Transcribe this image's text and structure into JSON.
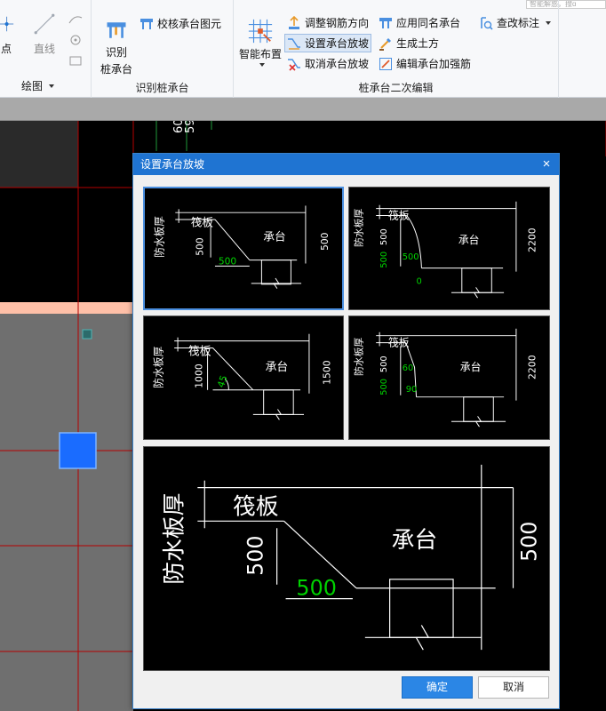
{
  "ribbon": {
    "search_hint": "智能解惑，搜ɑ",
    "draw_group": {
      "point_label": "点",
      "line_label": "直线",
      "group_label": "绘图"
    },
    "identify_group": {
      "check_label": "校核承台图元",
      "identify_label_line1": "识别",
      "identify_label_line2": "桩承台",
      "group_label": "识别桩承台"
    },
    "edit_group": {
      "smart_layout_label": "智能布置",
      "adjust_rebar_label": "调整钢筋方向",
      "set_slope_label": "设置承台放坡",
      "cancel_slope_label": "取消承台放坡",
      "apply_same_label": "应用同名承台",
      "gen_earth_label": "生成土方",
      "edit_reinforce_label": "编辑承台加强筋",
      "modify_mark_label": "查改标注",
      "group_label": "桩承台二次编辑"
    }
  },
  "canvas": {
    "dim_text_1": "60",
    "dim_text_2": "59"
  },
  "dialog": {
    "title": "设置承台放坡",
    "close_glyph": "×",
    "ok_label": "确定",
    "cancel_label": "取消",
    "diagram_labels": {
      "waterproof": "防水板厚",
      "raft": "筏板",
      "cap": "承台"
    },
    "panel1": {
      "depth": "500",
      "width": "500",
      "cap_height": "500"
    },
    "panel2": {
      "depth": "500",
      "depth_green": "500",
      "width": "500",
      "zero": "0",
      "cap_height": "2200"
    },
    "panel3": {
      "depth": "1000",
      "angle": "45",
      "cap_height": "1500"
    },
    "panel4": {
      "depth": "500",
      "depth_green": "500",
      "angle_top": "60",
      "angle_bottom": "90",
      "cap_height": "2200"
    },
    "preview": {
      "depth": "500",
      "width": "500",
      "cap_height": "500"
    }
  },
  "colors": {
    "accent": "#1f74d2",
    "diagram_line": "#ffffff",
    "diagram_value": "#00d200",
    "cad_red": "#b40000",
    "cad_green": "#1f9a3a"
  }
}
